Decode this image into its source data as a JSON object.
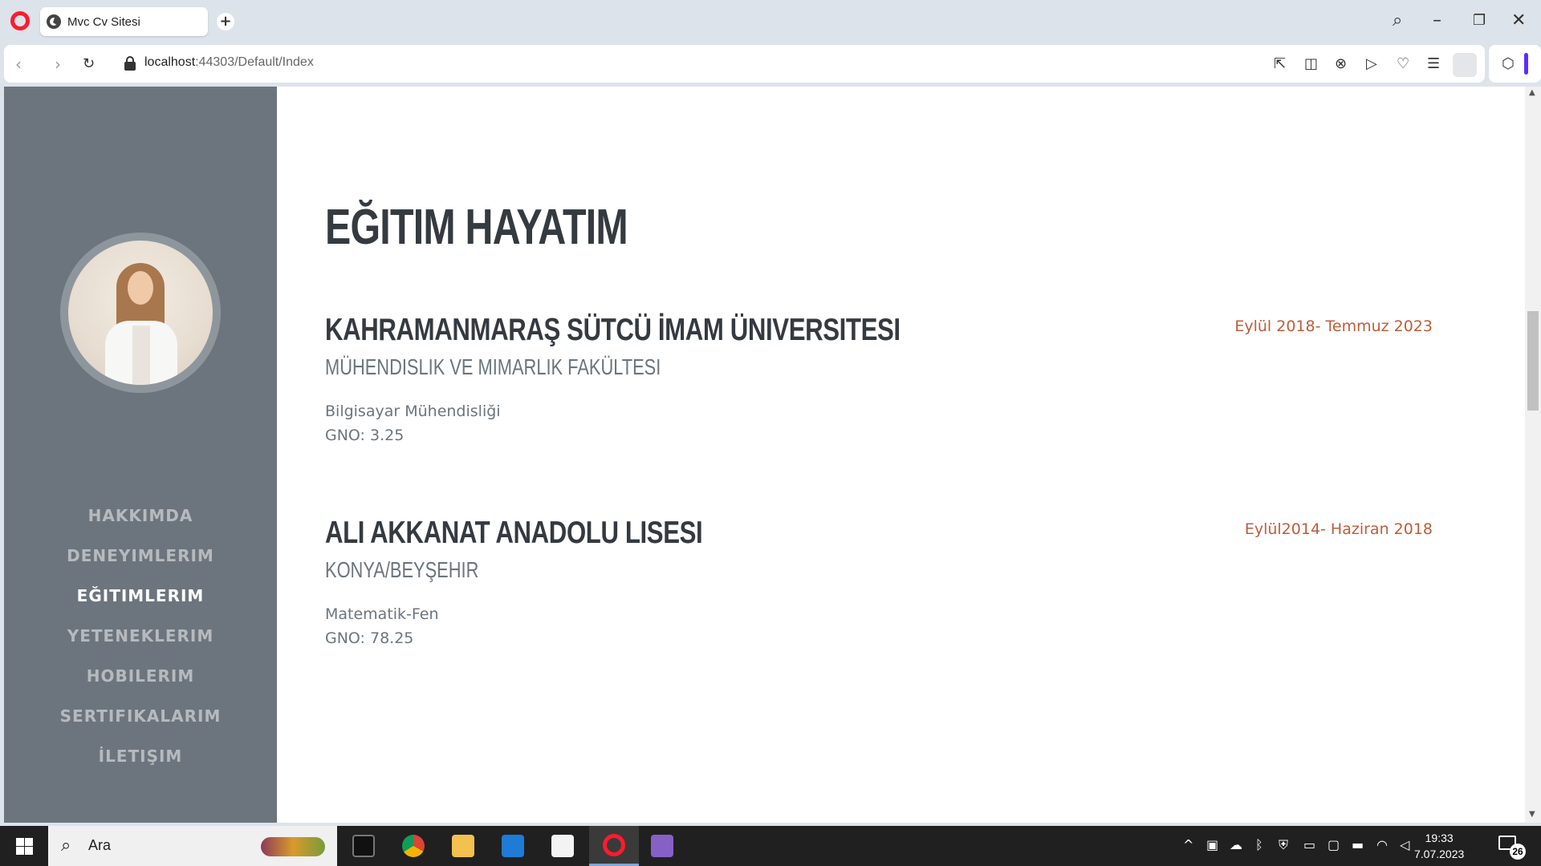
{
  "browser": {
    "tab_title": "Mvc Cv Sitesi",
    "url_host": "localhost",
    "url_rest": ":44303/Default/Index"
  },
  "sidebar": {
    "nav": [
      {
        "label": "HAKKIMDA",
        "active": false
      },
      {
        "label": "DENEYIMLERIM",
        "active": false
      },
      {
        "label": "EĞITIMLERIM",
        "active": true
      },
      {
        "label": "YETENEKLERIM",
        "active": false
      },
      {
        "label": "HOBILERIM",
        "active": false
      },
      {
        "label": "SERTIFIKALARIM",
        "active": false
      },
      {
        "label": "İLETIŞIM",
        "active": false
      }
    ]
  },
  "main": {
    "title": "EĞITIM HAYATIM",
    "entries": [
      {
        "name": "KAHRAMANMARAŞ SÜTCÜ İMAM ÜNIVERSITESI",
        "subtitle": "MÜHENDISLIK VE MIMARLIK FAKÜLTESI",
        "detail_line1": "Bilgisayar Mühendisliği",
        "detail_line2": "GNO: 3.25",
        "date": "Eylül 2018- Temmuz 2023"
      },
      {
        "name": "ALI AKKANAT ANADOLU LISESI",
        "subtitle": "KONYA/BEYŞEHIR",
        "detail_line1": "Matematik-Fen",
        "detail_line2": "GNO: 78.25",
        "date": "Eylül2014- Haziran 2018"
      }
    ]
  },
  "taskbar": {
    "search_placeholder": "Ara",
    "time": "19:33",
    "date": "7.07.2023",
    "notification_count": "26"
  },
  "colors": {
    "sidebar_bg": "#6c757d",
    "heading": "#343a40",
    "accent_date": "#bd5d38"
  }
}
